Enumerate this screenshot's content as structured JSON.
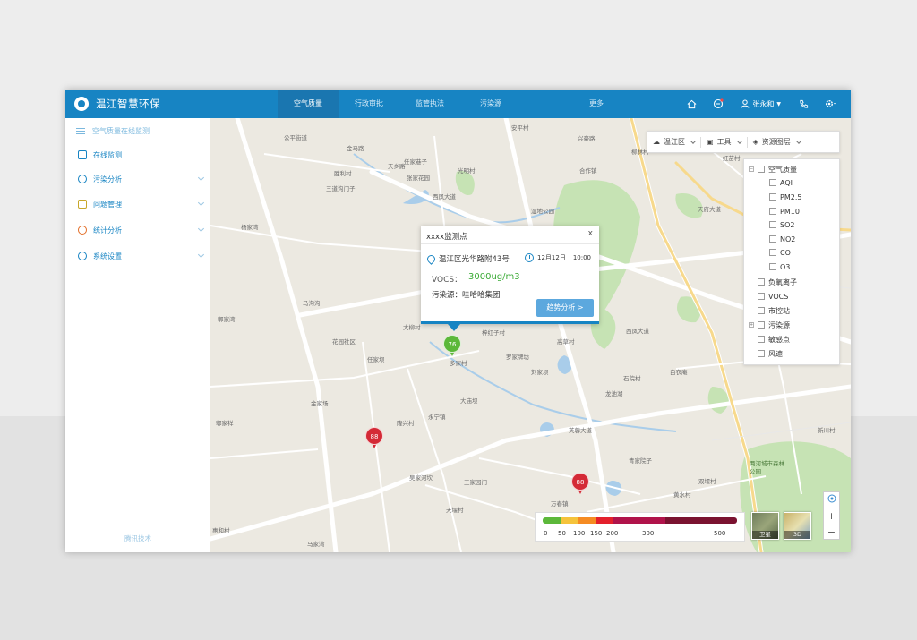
{
  "app": {
    "title": "温江智慧环保"
  },
  "nav": {
    "items": [
      {
        "label": "空气质量",
        "active": true
      },
      {
        "label": "行政审批"
      },
      {
        "label": "监管执法"
      },
      {
        "label": "污染源"
      },
      {
        "label": "更多"
      }
    ]
  },
  "header": {
    "user_name": "张永和"
  },
  "sidebar": {
    "heading": "空气质量在线监测",
    "items": [
      {
        "label": "在线监测"
      },
      {
        "label": "污染分析"
      },
      {
        "label": "问题管理"
      },
      {
        "label": "统计分析"
      },
      {
        "label": "系统设置"
      }
    ],
    "footer": "腾讯技术"
  },
  "map_toolbar": {
    "district": "温江区",
    "tools": "工具",
    "layers": "资源图层"
  },
  "layer_panel": {
    "root": "空气质量",
    "air_items": [
      "AQI",
      "PM2.5",
      "PM10",
      "SO2",
      "NO2",
      "CO",
      "O3"
    ],
    "other_items": [
      "负氧离子",
      "VOCS",
      "市控站",
      "污染源",
      "敏感点",
      "风速"
    ]
  },
  "popup": {
    "title": "xxxx监测点",
    "close": "x",
    "address": "温江区光华路附43号",
    "date": "12月12日",
    "time": "10:00",
    "metric": "VOCS：",
    "value": "3000ug/m3",
    "source": "污染源：哇哈哈集团",
    "button": "趋势分析 >"
  },
  "markers": [
    {
      "value": "76",
      "color": "#5cb83a"
    },
    {
      "value": "88",
      "color": "#d42a36"
    },
    {
      "value": "88",
      "color": "#d42a36"
    }
  ],
  "legend": {
    "ticks": [
      "0",
      "50",
      "100",
      "150",
      "200",
      "300",
      "500"
    ],
    "colors": [
      "#5cb83a",
      "#f5c33b",
      "#f58b22",
      "#e3202b",
      "#b0134a",
      "#7a1230"
    ]
  },
  "map_type": {
    "satellite": "卫星",
    "three_d": "3D"
  },
  "zoom": {
    "in": "+",
    "out": "−"
  },
  "map_labels": [
    "公平街道",
    "金马路",
    "天乡路",
    "任家巷子",
    "光明村",
    "安平村",
    "柳林村",
    "兴豪路",
    "胜利村",
    "三道沟门子",
    "张家花园",
    "西凤大道",
    "合作镇",
    "湿地公园",
    "天府大道",
    "红苗村",
    "杨家湾",
    "马沟沟",
    "大柳村",
    "梓红子村",
    "高草村",
    "西凤大道",
    "郫家湾",
    "花园社区",
    "任家坝",
    "多家村",
    "罗家牌坊",
    "刘家坝",
    "石院村",
    "白衣庵",
    "龙池湖",
    "永宁镇",
    "隆兴村",
    "大庙坝",
    "金家场",
    "芙蓉大道",
    "王家园门",
    "吴家河坎",
    "青家院子",
    "黄水村",
    "天堰村",
    "郫家祥",
    "万春镇",
    "双堰村",
    "马家湾",
    "两河城市森林公园",
    "新川村",
    "惠和村"
  ]
}
